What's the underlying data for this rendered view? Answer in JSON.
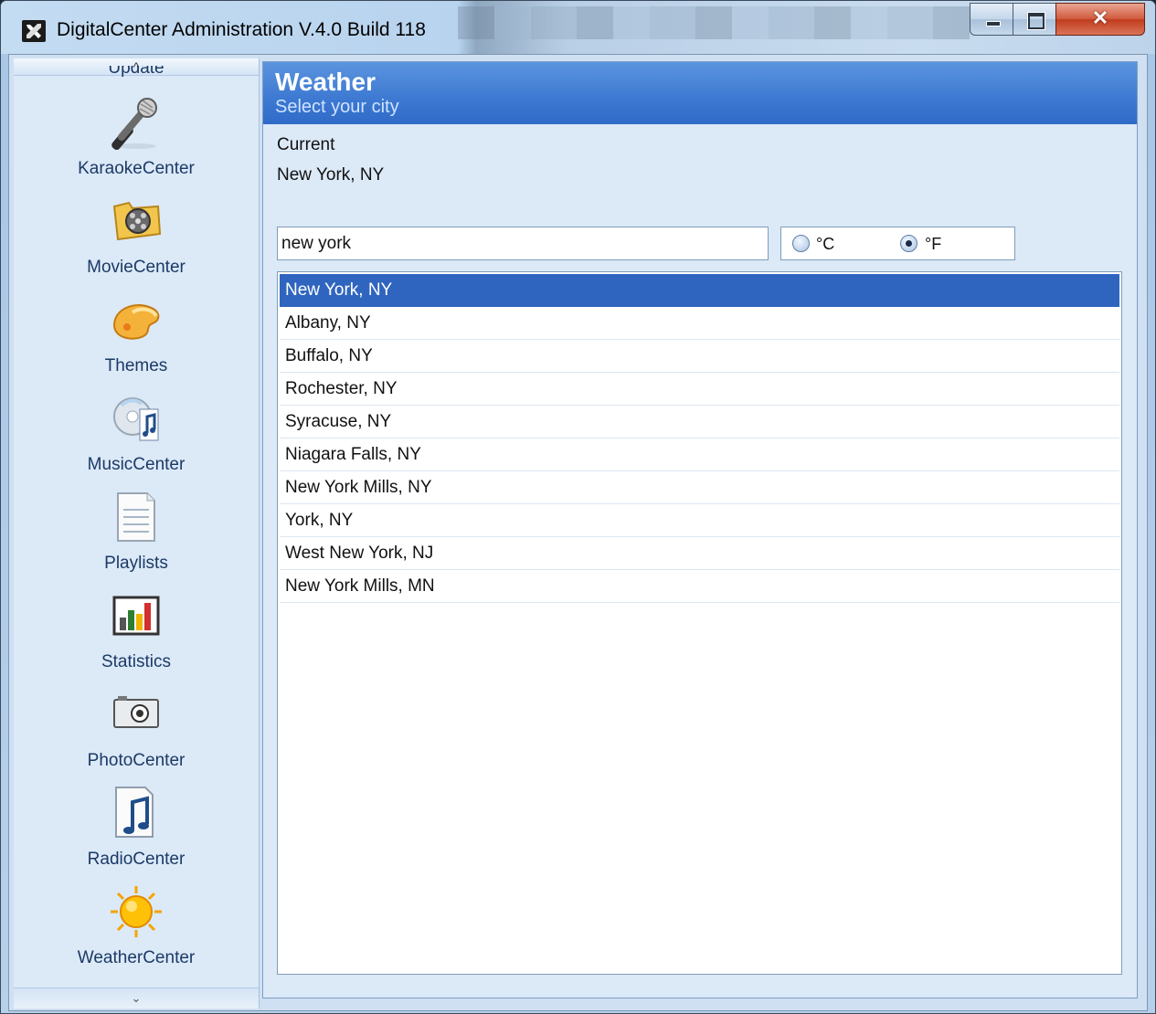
{
  "window": {
    "title": "DigitalCenter Administration V.4.0 Build 118",
    "icons": {
      "app": "tools-icon",
      "minimize": "minimize-icon",
      "maximize": "maximize-icon",
      "close": "close-icon"
    }
  },
  "sidebar": {
    "scroll_up_glyph": "^",
    "scroll_down_glyph": "⌄",
    "partial_item": "Update",
    "items": [
      {
        "label": "KaraokeCenter",
        "icon": "microphone-icon"
      },
      {
        "label": "MovieCenter",
        "icon": "film-reel-icon"
      },
      {
        "label": "Themes",
        "icon": "palette-icon"
      },
      {
        "label": "MusicCenter",
        "icon": "music-cd-icon"
      },
      {
        "label": "Playlists",
        "icon": "document-list-icon"
      },
      {
        "label": "Statistics",
        "icon": "bar-chart-icon"
      },
      {
        "label": "PhotoCenter",
        "icon": "camera-icon"
      },
      {
        "label": "RadioCenter",
        "icon": "music-note-icon"
      },
      {
        "label": "WeatherCenter",
        "icon": "sun-icon"
      }
    ]
  },
  "panel": {
    "title": "Weather",
    "subtitle": "Select your city",
    "current_label": "Current",
    "current_value": "New York, NY",
    "search_value": "new york",
    "units": {
      "celsius": "°C",
      "fahrenheit": "°F",
      "selected": "°F"
    },
    "cities": [
      "New York, NY",
      "Albany, NY",
      "Buffalo, NY",
      "Rochester, NY",
      "Syracuse, NY",
      "Niagara Falls, NY",
      "New York Mills, NY",
      "York, NY",
      "West New York, NJ",
      "New York Mills, MN"
    ],
    "selected_city_index": 0
  },
  "colors": {
    "header_blue": "#3f7bd3",
    "selection_blue": "#2f65bf",
    "sidebar_bg": "#dce9f7"
  }
}
